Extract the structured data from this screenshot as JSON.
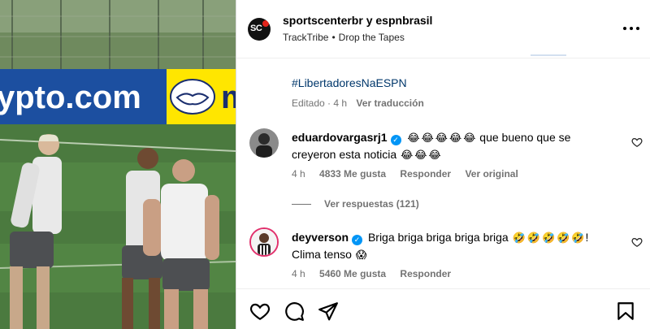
{
  "header": {
    "author_primary": "sportscenterbr",
    "conjunction": "y",
    "author_secondary": "espnbrasil",
    "audio_artist": "TrackTribe",
    "audio_separator": "•",
    "audio_title": "Drop the Tapes",
    "avatar_text": "SC"
  },
  "media": {
    "banner_text": "ypto.com",
    "banner_text_2": "m",
    "icon": "handshake-logo"
  },
  "caption": {
    "hashtag": "#LibertadoresNaESPN",
    "edited": "Editado",
    "time": "4 h",
    "dot": "·",
    "see_translation": "Ver traducción"
  },
  "comments": [
    {
      "username": "eduardovargasrj1",
      "verified": true,
      "emojis_before": [
        "😂",
        "😂",
        "😂",
        "😂",
        "😂"
      ],
      "text": "que bueno que se creyeron esta noticia",
      "emojis_after": [
        "😂",
        "😂",
        "😂"
      ],
      "time": "4 h",
      "likes": "4833 Me gusta",
      "reply": "Responder",
      "see_original": "Ver original"
    },
    {
      "username": "deyverson",
      "verified": true,
      "text": "Briga briga briga briga briga",
      "emojis_after": [
        "🤣",
        "🤣",
        "🤣",
        "🤣",
        "🤣"
      ],
      "text_2": "!",
      "text_3": "Clima tenso",
      "emoji_end": "😱",
      "time": "4 h",
      "likes": "5460 Me gusta",
      "reply": "Responder"
    }
  ],
  "replies": {
    "label": "Ver respuestas (121)"
  },
  "actions": {
    "like_icon": "heart-icon",
    "comment_icon": "comment-icon",
    "share_icon": "send-icon",
    "save_icon": "bookmark-icon"
  },
  "colors": {
    "link": "#00376b",
    "verified": "#0095f6",
    "muted": "#737373",
    "banner_blue": "#1c4fa0",
    "banner_yellow": "#ffe600"
  }
}
